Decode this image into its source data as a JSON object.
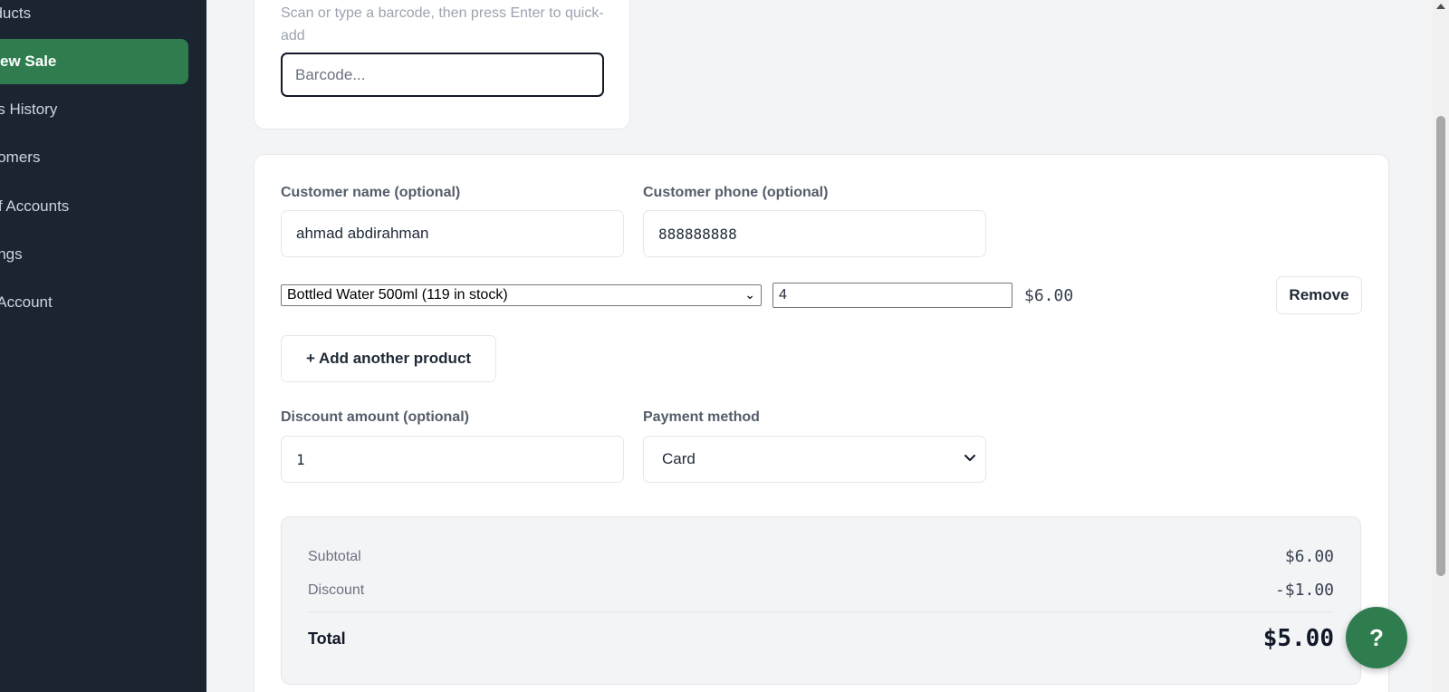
{
  "sidebar": {
    "items": [
      {
        "label": "oducts",
        "active": false
      },
      {
        "label": "ew Sale",
        "active": true
      },
      {
        "label": "les History",
        "active": false
      },
      {
        "label": "stomers",
        "active": false
      },
      {
        "label": "aff Accounts",
        "active": false
      },
      {
        "label": "ttings",
        "active": false
      },
      {
        "label": "y Account",
        "active": false
      }
    ],
    "active_color": "#2f7d4f",
    "background_color": "#1b2431"
  },
  "barcode": {
    "hint": "Scan or type a barcode, then press Enter to quick-add",
    "placeholder": "Barcode...",
    "value": ""
  },
  "customer": {
    "name_label": "Customer name (optional)",
    "name_value": "ahmad abdirahman",
    "phone_label": "Customer phone (optional)",
    "phone_value": "888888888"
  },
  "line_items": [
    {
      "product": "Bottled Water 500ml (119 in stock)",
      "quantity": "4",
      "price": "$6.00",
      "remove_label": "Remove"
    }
  ],
  "add_product_label": "+ Add another product",
  "discount": {
    "label": "Discount amount (optional)",
    "value": "1"
  },
  "payment": {
    "label": "Payment method",
    "selected": "Card"
  },
  "summary": {
    "subtotal_label": "Subtotal",
    "subtotal_value": "$6.00",
    "discount_label": "Discount",
    "discount_value": "-$1.00",
    "total_label": "Total",
    "total_value": "$5.00"
  },
  "help_label": "?",
  "icons": {
    "select_chevron": "chevron-down-icon",
    "scroll_up": "arrow-up-icon"
  }
}
